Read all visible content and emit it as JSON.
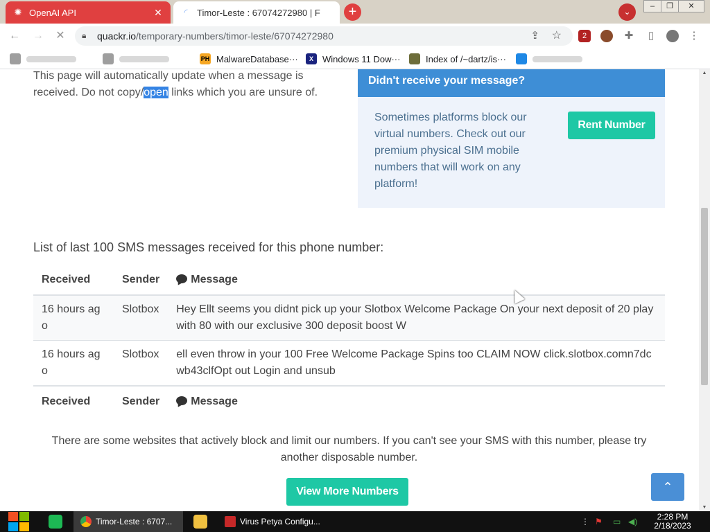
{
  "browser": {
    "tabs": [
      {
        "title": "OpenAI API",
        "icon": "openai-icon",
        "active": false
      },
      {
        "title": "Timor-Leste : 67074272980 | F",
        "icon": "loading-spinner-icon",
        "active": true
      }
    ],
    "new_tab": "+",
    "tab_search": "⌄",
    "window_controls": [
      "–",
      "❐",
      "✕"
    ],
    "address": {
      "host": "quackr.io",
      "path": "/temporary-numbers/timor-leste/67074272980"
    },
    "extension_badge": "2",
    "accent": "#e04040"
  },
  "bookmarks": {
    "items": [
      {
        "label": "",
        "icon": "bookmark-icon",
        "redacted": true
      },
      {
        "label": "",
        "icon": "bookmark-icon",
        "redacted": true
      },
      {
        "label": "MalwareDatabase···",
        "icon": "ph-icon",
        "badge": "PH"
      },
      {
        "label": "Windows 11 Dow···",
        "icon": "x-icon",
        "badge": "X"
      },
      {
        "label": "Index of /~dartz/is···",
        "icon": "bookmark-icon"
      },
      {
        "label": "",
        "icon": "bookmark-icon",
        "redacted": true
      }
    ]
  },
  "page": {
    "intro": {
      "before": "This page will automatically update when a message is received. Do not copy/",
      "highlight": "open",
      "after": " links which you are unsure of."
    },
    "notice": {
      "title": "Didn't receive your message?",
      "body": "Sometimes platforms block our virtual numbers. Check out our premium physical SIM mobile numbers that will work on any platform!",
      "button": "Rent Number"
    },
    "list_title": "List of last 100 SMS messages received for this phone number:",
    "table": {
      "headers": [
        "Received",
        "Sender",
        "Message"
      ],
      "rows": [
        {
          "received": "16 hours ago",
          "sender": "Slotbox",
          "message": "Hey Ellt seems you didnt pick up your Slotbox Welcome Package On your next deposit of 20 play with 80 with our exclusive 300 deposit boost W"
        },
        {
          "received": "16 hours ago",
          "sender": "Slotbox",
          "message": "ell even throw in your 100 Free Welcome Package Spins too CLAIM NOW click.slotbox.comn7dcwb43clfOpt out Login and unsub"
        }
      ]
    },
    "footnote": "There are some websites that actively block and limit our numbers. If you can't see your SMS with this number, please try another disposable number.",
    "more_button": "View More Numbers",
    "back_to_top": "⌃",
    "colors": {
      "primary": "#3e8ed6",
      "teal": "#1ec8a5",
      "notice_bg": "#eef3fb"
    }
  },
  "taskbar": {
    "apps": [
      {
        "label": "Timor-Leste : 6707...",
        "icon": "chrome-icon"
      },
      {
        "label": "Virus Petya Configu...",
        "icon": "petya-skull-icon"
      }
    ],
    "clock": {
      "time": "2:28 PM",
      "date": "2/18/2023"
    }
  }
}
